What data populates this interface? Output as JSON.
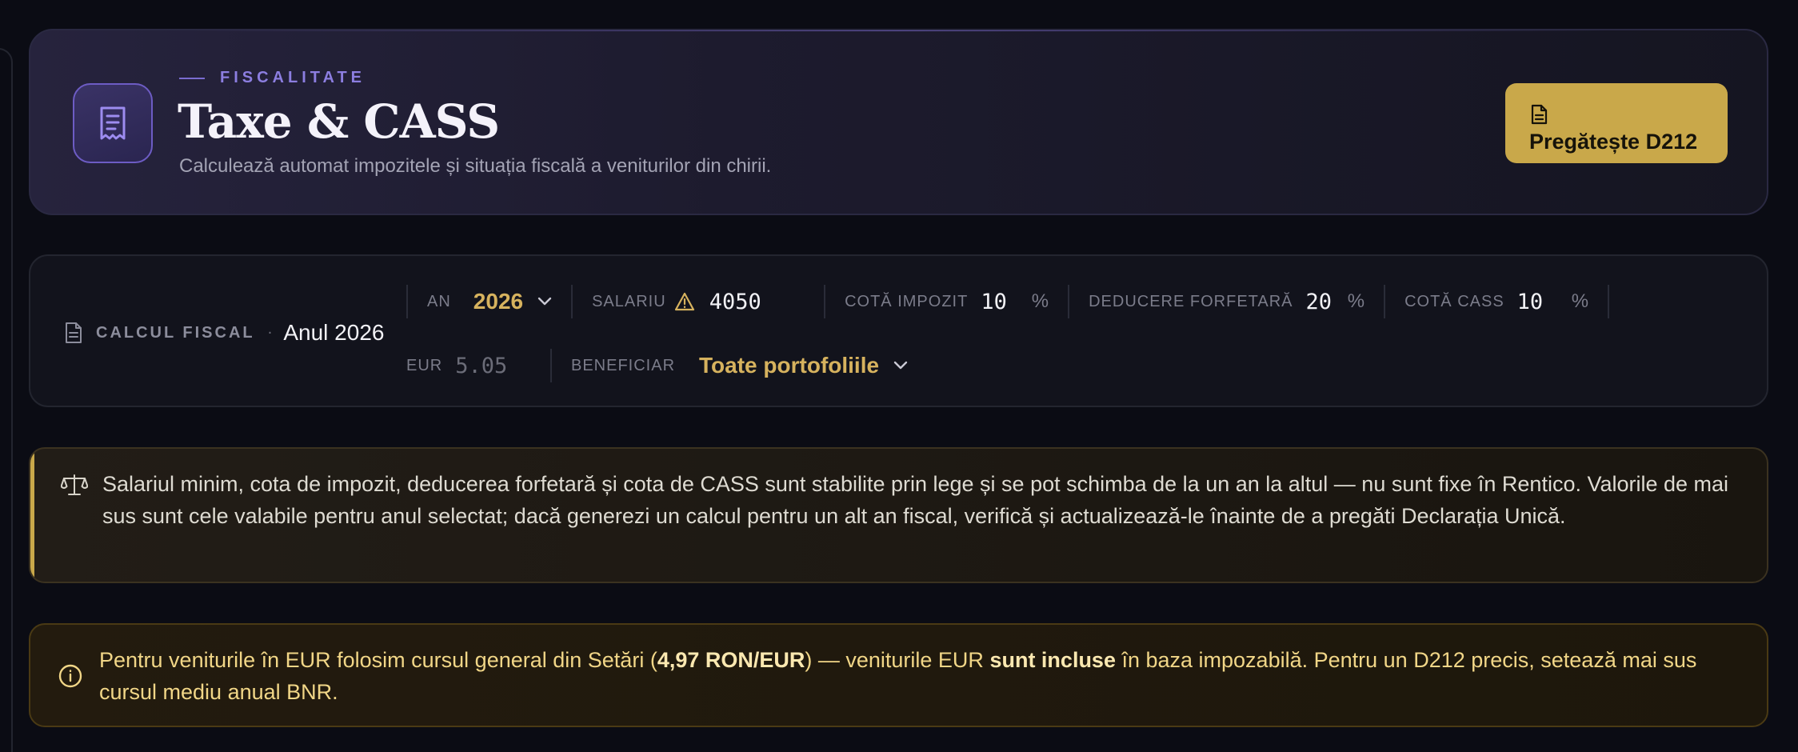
{
  "header": {
    "eyebrow": "FISCALITATE",
    "title": "Taxe & CASS",
    "subtitle": "Calculează automat impozitele și situația fiscală a veniturilor din chirii.",
    "icon": "receipt-icon",
    "primary_button_label": "Pregătește D212",
    "primary_button_icon": "document-icon"
  },
  "filters": {
    "section_label": "CALCUL FISCAL",
    "separator": "·",
    "year_display": "Anul 2026",
    "an": {
      "label": "AN",
      "value": "2026"
    },
    "salariu": {
      "label": "SALARIU",
      "value": "4050",
      "icon": "warning-icon"
    },
    "cota_impozit": {
      "label": "COTĂ IMPOZIT",
      "value": "10",
      "unit": "%"
    },
    "deducere": {
      "label": "DEDUCERE FORFETARĂ",
      "value": "20",
      "unit": "%"
    },
    "cota_cass": {
      "label": "COTĂ CASS",
      "value": "10",
      "unit": "%"
    },
    "eur": {
      "label": "EUR",
      "placeholder": "5.05"
    },
    "beneficiar": {
      "label": "BENEFICIAR",
      "value": "Toate portofoliile"
    }
  },
  "alerts": {
    "law_notice": {
      "icon": "scales-icon",
      "text": "Salariul minim, cota de impozit, deducerea forfetară și cota de CASS sunt stabilite prin lege și se pot schimba de la un an la altul — nu sunt fixe în Rentico. Valorile de mai sus sunt cele valabile pentru anul selectat; dacă generezi un calcul pentru un alt an fiscal, verifică și actualizează-le înainte de a pregăti Declarația Unică."
    },
    "eur_notice": {
      "icon": "info-icon",
      "text_before": "Pentru veniturile în EUR folosim cursul general din Setări (",
      "rate": "4,97 RON/EUR",
      "text_middle": ") — veniturile EUR ",
      "emphasis": "sunt incluse",
      "text_after": " în baza impozabilă. Pentru un D212 precis, setează mai sus cursul mediu anual BNR."
    }
  },
  "colors": {
    "accent_gold": "#c9a84a",
    "accent_purple": "#8c7ee0",
    "background": "#0b0c14"
  }
}
